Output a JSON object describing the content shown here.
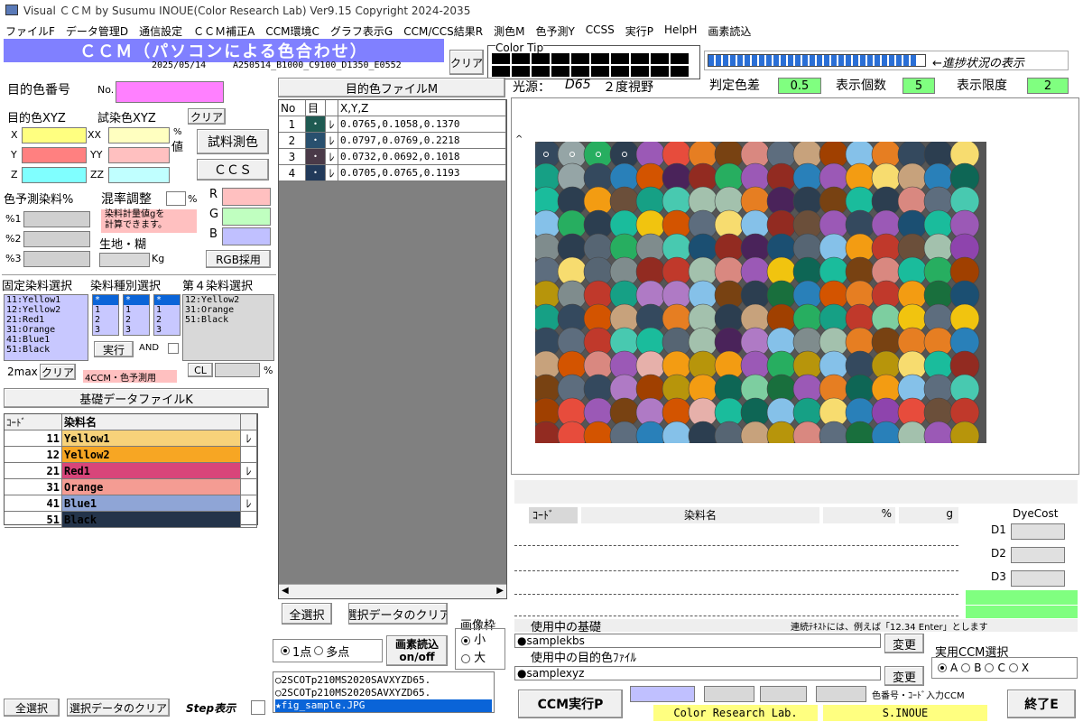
{
  "window": {
    "title": "Visual ＣＣＭ by Susumu INOUE(Color Research Lab)  Ver9.15 Copyright 2024-2035"
  },
  "menu": [
    "ファイルF",
    "データ管理D",
    "通信設定",
    "ＣＣＭ補正A",
    "CCM環境C",
    "グラフ表示G",
    "CCM/CCS結果R",
    "測色M",
    "色予測Y",
    "CCSS",
    "実行P",
    "HelpH",
    "画素読込"
  ],
  "banner": {
    "title": "ＣＣＭ（パソコンによる色合わせ）",
    "date": "2025/05/14",
    "code": "A250514_B1000_C9100_D1350_E0552"
  },
  "colortip": {
    "clear": "クリア",
    "label": "Color Tip"
  },
  "progress": {
    "label": "←進捗状況の表示",
    "filled_fraction": 0.96
  },
  "target": {
    "number_label": "目的色番号",
    "no_label": "No.",
    "xyz_label": "目的色XYZ",
    "trial_label": "試染色XYZ",
    "clear": "クリア",
    "x": "X",
    "y": "Y",
    "z": "Z",
    "xx": "XX",
    "yy": "YY",
    "zz": "ZZ",
    "pct": "%",
    "val": "値",
    "trial_measure": "試料測色",
    "ccs": "ＣＣＳ"
  },
  "predict": {
    "label": "色予測染料%",
    "mix_label": "混率調整",
    "mix_pct": "%",
    "p1": "%1",
    "p2": "%2",
    "p3": "%3",
    "note1": "染料計量値gを",
    "note2": "計算できます。",
    "fabric": "生地・糊",
    "kg": "Kg",
    "r": "R",
    "g": "G",
    "b": "B",
    "rgb_btn": "RGB採用"
  },
  "fixed": {
    "label": "固定染料選択",
    "kind_label": "染料種別選択",
    "fourth_label": "第４染料選択",
    "list1": [
      "11:Yellow1",
      "12:Yellow2",
      "21:Red1",
      "31:Orange",
      "41:Blue1",
      "51:Black"
    ],
    "col_a": [
      "*",
      "1",
      "2",
      "3"
    ],
    "col_b": [
      "*",
      "1",
      "2",
      "3"
    ],
    "col_c": [
      "*",
      "1",
      "2",
      "3"
    ],
    "list4": [
      "12:Yellow2",
      "31:Orange",
      "51:Black"
    ],
    "exec": "実行",
    "and": "AND",
    "max": "2max",
    "clear": "クリア",
    "cl": "CL",
    "note": "4CCM・色予測用",
    "pct": "%"
  },
  "basefile": {
    "button": "基礎データファイルK",
    "h_code": "ｺｰﾄﾞ",
    "h_name": "染料名",
    "rows": [
      {
        "code": "11",
        "name": "Yellow1",
        "check": "ﾚ",
        "color": "#f7d27a"
      },
      {
        "code": "12",
        "name": "Yellow2",
        "check": "",
        "color": "#f7a623"
      },
      {
        "code": "21",
        "name": "Red1",
        "check": "ﾚ",
        "color": "#d8457a"
      },
      {
        "code": "31",
        "name": "Orange",
        "check": "",
        "color": "#f49c93"
      },
      {
        "code": "41",
        "name": "Blue1",
        "check": "ﾚ",
        "color": "#8fa5d6"
      },
      {
        "code": "51",
        "name": "Black",
        "check": "",
        "color": "#24344a"
      }
    ]
  },
  "targetfile": {
    "button": "目的色ファイルM",
    "h_no": "No",
    "h_mark": "目",
    "h_xyz": "X,Y,Z",
    "rows": [
      {
        "no": "1",
        "color": "#1f5a52",
        "check": "ﾚ",
        "xyz": "0.0765,0.1058,0.1370"
      },
      {
        "no": "2",
        "color": "#29506e",
        "check": "ﾚ",
        "xyz": "0.0797,0.0769,0.2218"
      },
      {
        "no": "3",
        "color": "#4a3a48",
        "check": "ﾚ",
        "xyz": "0.0732,0.0692,0.1018"
      },
      {
        "no": "4",
        "color": "#223a5a",
        "check": "ﾚ",
        "xyz": "0.0705,0.0765,0.1193"
      }
    ]
  },
  "bottom_left": {
    "select_all": "全選択",
    "clear_sel": "選択データのクリア",
    "step": "Step表示"
  },
  "mid": {
    "select_all": "全選択",
    "clear_sel": "選択データのクリア",
    "one_point": "1点",
    "multi": "多点",
    "pixel_btn1": "画素読込",
    "pixel_btn2": "on/off",
    "frame": "画像枠",
    "small": "小",
    "large": "大",
    "files": [
      "2SCOTp210MS2020SAVXYZD65.",
      "2SCOTp210MS2020SAVXYZD65.",
      "★fig_sample.JPG"
    ]
  },
  "right": {
    "illum_label": "光源：",
    "illum": "D65",
    "view": "２度視野",
    "judge_label": "判定色差",
    "judge": "0.5",
    "count_label": "表示個数",
    "count": "5",
    "limit_label": "表示限度",
    "limit": "2",
    "h_code": "ｺｰﾄﾞ",
    "h_name": "染料名",
    "h_pct": "%",
    "h_g": "g",
    "dyecost": "DyeCost",
    "d1": "D1",
    "d2": "D2",
    "d3": "D3",
    "inuse_label": "使用中の基礎",
    "inuse_note": "連続ﾃｷｽﾄには、例えば「12.34 Enter」とします",
    "base_file": "●samplekbs",
    "target_label": "使用中の目的色ﾌｧｲﾙ",
    "target_file": "●samplexyz",
    "change": "変更",
    "ccm_select": "実用CCM選択",
    "ccm_options": [
      "A",
      "B",
      "C",
      "X"
    ],
    "ccm_exec": "CCM実行P",
    "input_note": "色番号・ｺｰﾄﾞ入力CCM",
    "lab": "Color Research Lab.",
    "author": "S.INOUE",
    "end": "終了E"
  },
  "colors": {
    "accent": "#8080ff",
    "pink": "#ff80ff",
    "green": "#80ff80",
    "yellow": "#ffff80",
    "progress": "#2a6fd6"
  }
}
